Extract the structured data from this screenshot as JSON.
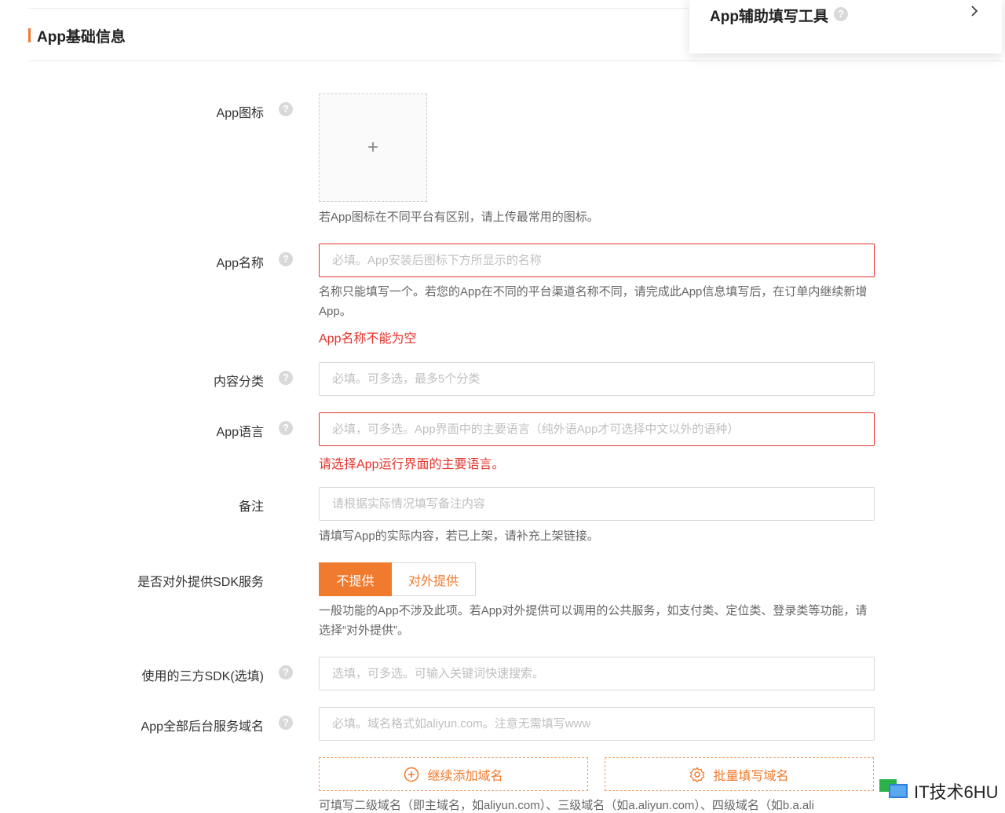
{
  "section": {
    "title": "App基础信息"
  },
  "helper_tool": {
    "title": "App辅助填写工具"
  },
  "form": {
    "icon": {
      "label": "App图标",
      "plus": "+",
      "hint": "若App图标在不同平台有区别，请上传最常用的图标。"
    },
    "name": {
      "label": "App名称",
      "placeholder": "必填。App安装后图标下方所显示的名称",
      "hint": "名称只能填写一个。若您的App在不同的平台渠道名称不同，请完成此App信息填写后，在订单内继续新增App。",
      "error": "App名称不能为空"
    },
    "category": {
      "label": "内容分类",
      "placeholder": "必填。可多选，最多5个分类"
    },
    "language": {
      "label": "App语言",
      "placeholder": "必填，可多选。App界面中的主要语言（纯外语App才可选择中文以外的语种）",
      "error": "请选择App运行界面的主要语言。"
    },
    "remark": {
      "label": "备注",
      "placeholder": "请根据实际情况填写备注内容",
      "hint": "请填写App的实际内容，若已上架，请补充上架链接。"
    },
    "sdk_service": {
      "label": "是否对外提供SDK服务",
      "options": [
        "不提供",
        "对外提供"
      ],
      "selected": "不提供",
      "hint": "一般功能的App不涉及此项。若App对外提供可以调用的公共服务，如支付类、定位类、登录类等功能，请选择“对外提供”。"
    },
    "third_sdk": {
      "label": "使用的三方SDK(选填)",
      "placeholder": "选填，可多选。可输入关键词快速搜索。"
    },
    "domains": {
      "label": "App全部后台服务域名",
      "placeholder": "必填。域名格式如aliyun.com。注意无需填写www",
      "add_button": "继续添加域名",
      "batch_button": "批量填写域名",
      "hint_partial": "可填写二级域名（即主域名，如aliyun.com）、三级域名（如a.aliyun.com）、四级域名（如b.a.ali"
    }
  },
  "watermark": {
    "text": "IT技术6HU"
  },
  "colors": {
    "accent": "#f07a2d",
    "error": "#e5332c",
    "border": "#d9d9d9",
    "placeholder": "#c0c0c0"
  }
}
